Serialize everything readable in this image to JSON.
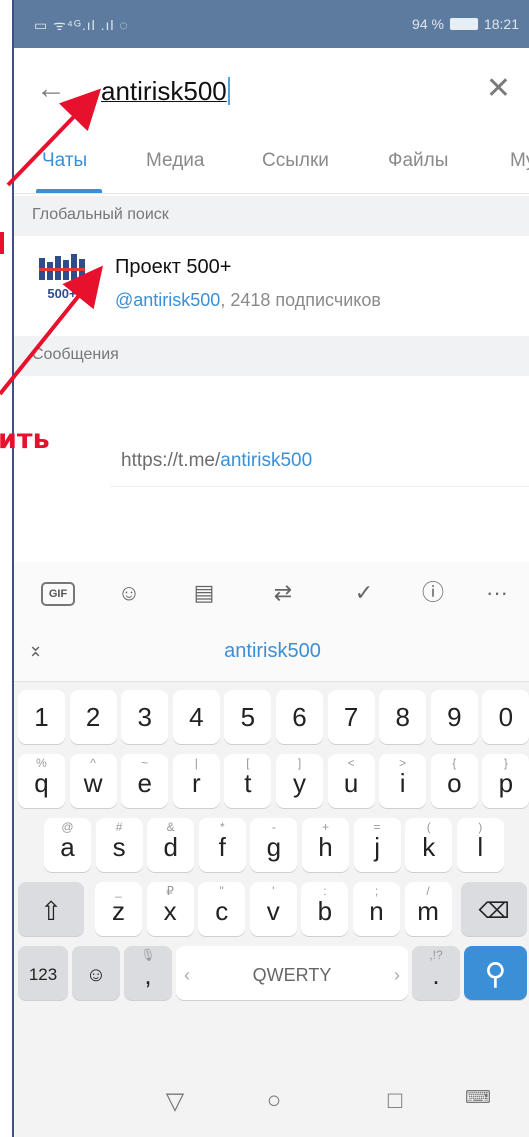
{
  "status_bar": {
    "left": "▭ ᯤ⁴ᴳ.ıl .ıl ◌",
    "battery": "94 %",
    "time": "18:21"
  },
  "search": {
    "query": "antirisk500"
  },
  "tabs": [
    {
      "label": "Чаты"
    },
    {
      "label": "Медиа"
    },
    {
      "label": "Ссылки"
    },
    {
      "label": "Файлы"
    },
    {
      "label": "My"
    }
  ],
  "sections": {
    "global": "Глобальный поиск",
    "messages": "Сообщения"
  },
  "result": {
    "logo_text": "500+",
    "title": "Проект 500+",
    "handle": "@antirisk500",
    "subscribers": ", 2418 подписчиков"
  },
  "message_link": {
    "prefix": "https://t.me/",
    "highlight": "antirisk500"
  },
  "keyboard": {
    "toolbar": {
      "gif": "GIF",
      "more": "···"
    },
    "suggestion": "antirisk500",
    "numbers": [
      "1",
      "2",
      "3",
      "4",
      "5",
      "6",
      "7",
      "8",
      "9",
      "0"
    ],
    "row1": [
      [
        "q",
        "%"
      ],
      [
        "w",
        "^"
      ],
      [
        "e",
        "~"
      ],
      [
        "r",
        "|"
      ],
      [
        "t",
        "["
      ],
      [
        "y",
        "]"
      ],
      [
        "u",
        "<"
      ],
      [
        "i",
        ">"
      ],
      [
        "o",
        "{"
      ],
      [
        "p",
        "}"
      ]
    ],
    "row2": [
      [
        "a",
        "@"
      ],
      [
        "s",
        "#"
      ],
      [
        "d",
        "&"
      ],
      [
        "f",
        "*"
      ],
      [
        "g",
        "-"
      ],
      [
        "h",
        "+"
      ],
      [
        "j",
        "="
      ],
      [
        "k",
        "("
      ],
      [
        "l",
        ")"
      ]
    ],
    "row3": [
      [
        "z",
        "_"
      ],
      [
        "x",
        "₽"
      ],
      [
        "c",
        "\""
      ],
      [
        "v",
        "'"
      ],
      [
        "b",
        ":"
      ],
      [
        "n",
        ";"
      ],
      [
        "m",
        "/"
      ]
    ],
    "num_switch": "123",
    "space_label": "QWERTY",
    "comma": ",",
    "period": ".",
    "period_sub": ",!?"
  },
  "annotation": {
    "text": "ить"
  },
  "colors": {
    "accent": "#3a8fd6",
    "annotation": "#e8112d",
    "status_bar": "#5d7b9f"
  }
}
